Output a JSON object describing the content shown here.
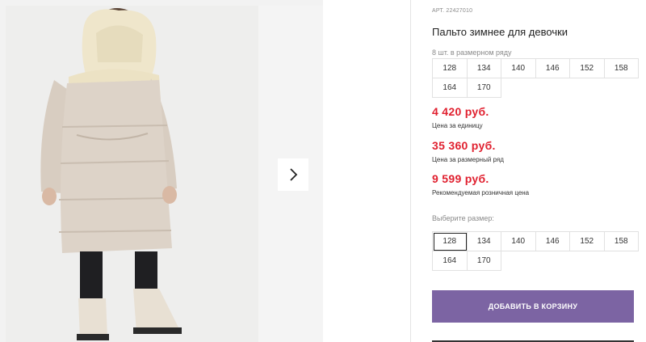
{
  "product": {
    "sku": "АРТ. 22427010",
    "title": "Пальто зимнее для девочки",
    "pack_note": "8 шт. в размерном ряду"
  },
  "pack_sizes": [
    "128",
    "134",
    "140",
    "146",
    "152",
    "158",
    "164",
    "170"
  ],
  "prices": {
    "unit_price": "4 420 руб.",
    "unit_label": "Цена за единицу",
    "pack_price": "35 360 руб.",
    "pack_label": "Цена за размерный ряд",
    "retail_price": "9 599 руб.",
    "retail_label": "Рекомендуемая розничная цена"
  },
  "size_picker": {
    "label": "Выберите размер:",
    "options": [
      "128",
      "134",
      "140",
      "146",
      "152",
      "158",
      "164",
      "170"
    ],
    "selected": "128"
  },
  "cart_button_label": "ДОБАВИТЬ В КОРЗИНУ",
  "colors": {
    "price": "#e0202f",
    "cart_button": "#7c64a3",
    "coat": "#ddd3c8",
    "fleece": "#f1e9cf"
  },
  "icons": {
    "gallery_next": "chevron-right-icon"
  }
}
